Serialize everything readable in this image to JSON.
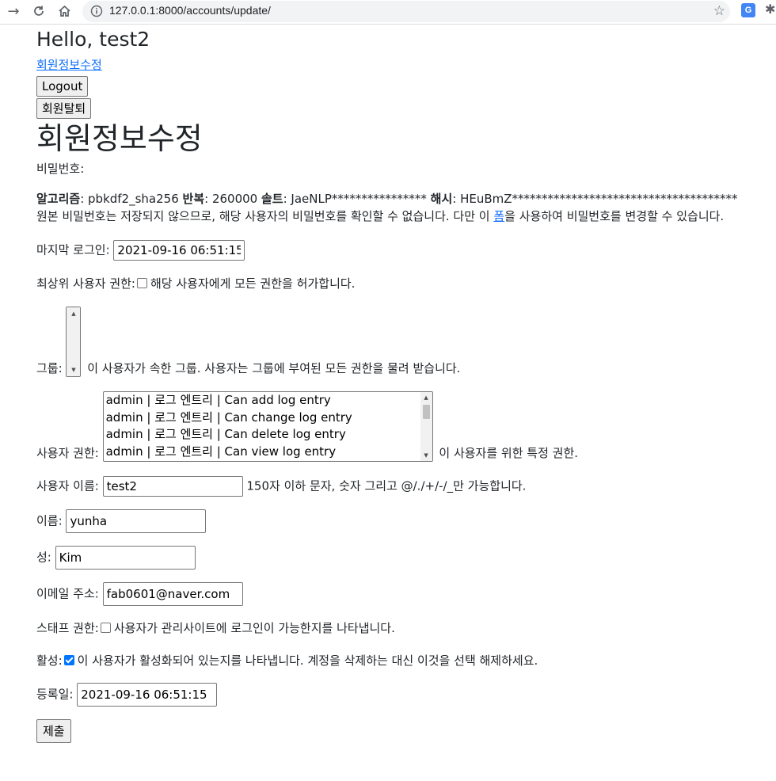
{
  "browser": {
    "url": "127.0.0.1:8000/accounts/update/"
  },
  "header": {
    "greeting": "Hello, test2",
    "profile_link": "회원정보수정",
    "logout_label": "Logout",
    "withdraw_label": "회원탈퇴"
  },
  "form": {
    "title": "회원정보수정",
    "password": {
      "label": "비밀번호:",
      "algorithm_label": "알고리즘",
      "algorithm_value": ": pbkdf2_sha256 ",
      "iterations_label": "반복",
      "iterations_value": ": 260000 ",
      "salt_label": "솔트",
      "salt_value": ": JaeNLP**************** ",
      "hash_label": "해시",
      "hash_value": ": HEuBmZ**************************************",
      "help_before": "원본 비밀번호는 저장되지 않으므로, 해당 사용자의 비밀번호를 확인할 수 없습니다. 다만 이 ",
      "help_link": "폼",
      "help_after": "을 사용하여 비밀번호를 변경할 수 있습니다."
    },
    "last_login": {
      "label": "마지막 로그인:",
      "value": "2021-09-16 06:51:15"
    },
    "superuser": {
      "label": "최상위 사용자 권한:",
      "checked": false,
      "help": "해당 사용자에게 모든 권한을 허가합니다."
    },
    "groups": {
      "label": "그룹:",
      "help": "이 사용자가 속한 그룹. 사용자는 그룹에 부여된 모든 권한을 물려 받습니다."
    },
    "user_permissions": {
      "label": "사용자 권한:",
      "options": [
        "admin | 로그 엔트리 | Can add log entry",
        "admin | 로그 엔트리 | Can change log entry",
        "admin | 로그 엔트리 | Can delete log entry",
        "admin | 로그 엔트리 | Can view log entry"
      ],
      "help": "이 사용자를 위한 특정 권한."
    },
    "username": {
      "label": "사용자 이름:",
      "value": "test2",
      "help": "150자 이하 문자, 숫자 그리고 @/./+/-/_만 가능합니다."
    },
    "first_name": {
      "label": "이름:",
      "value": "yunha"
    },
    "last_name": {
      "label": "성:",
      "value": "Kim"
    },
    "email": {
      "label": "이메일 주소:",
      "value": "fab0601@naver.com"
    },
    "is_staff": {
      "label": "스태프 권한:",
      "checked": false,
      "help": "사용자가 관리사이트에 로그인이 가능한지를 나타냅니다."
    },
    "is_active": {
      "label": "활성:",
      "checked": true,
      "help": "이 사용자가 활성화되어 있는지를 나타냅니다. 계정을 삭제하는 대신 이것을 선택 해제하세요."
    },
    "date_joined": {
      "label": "등록일:",
      "value": "2021-09-16 06:51:15"
    },
    "submit_label": "제출"
  }
}
